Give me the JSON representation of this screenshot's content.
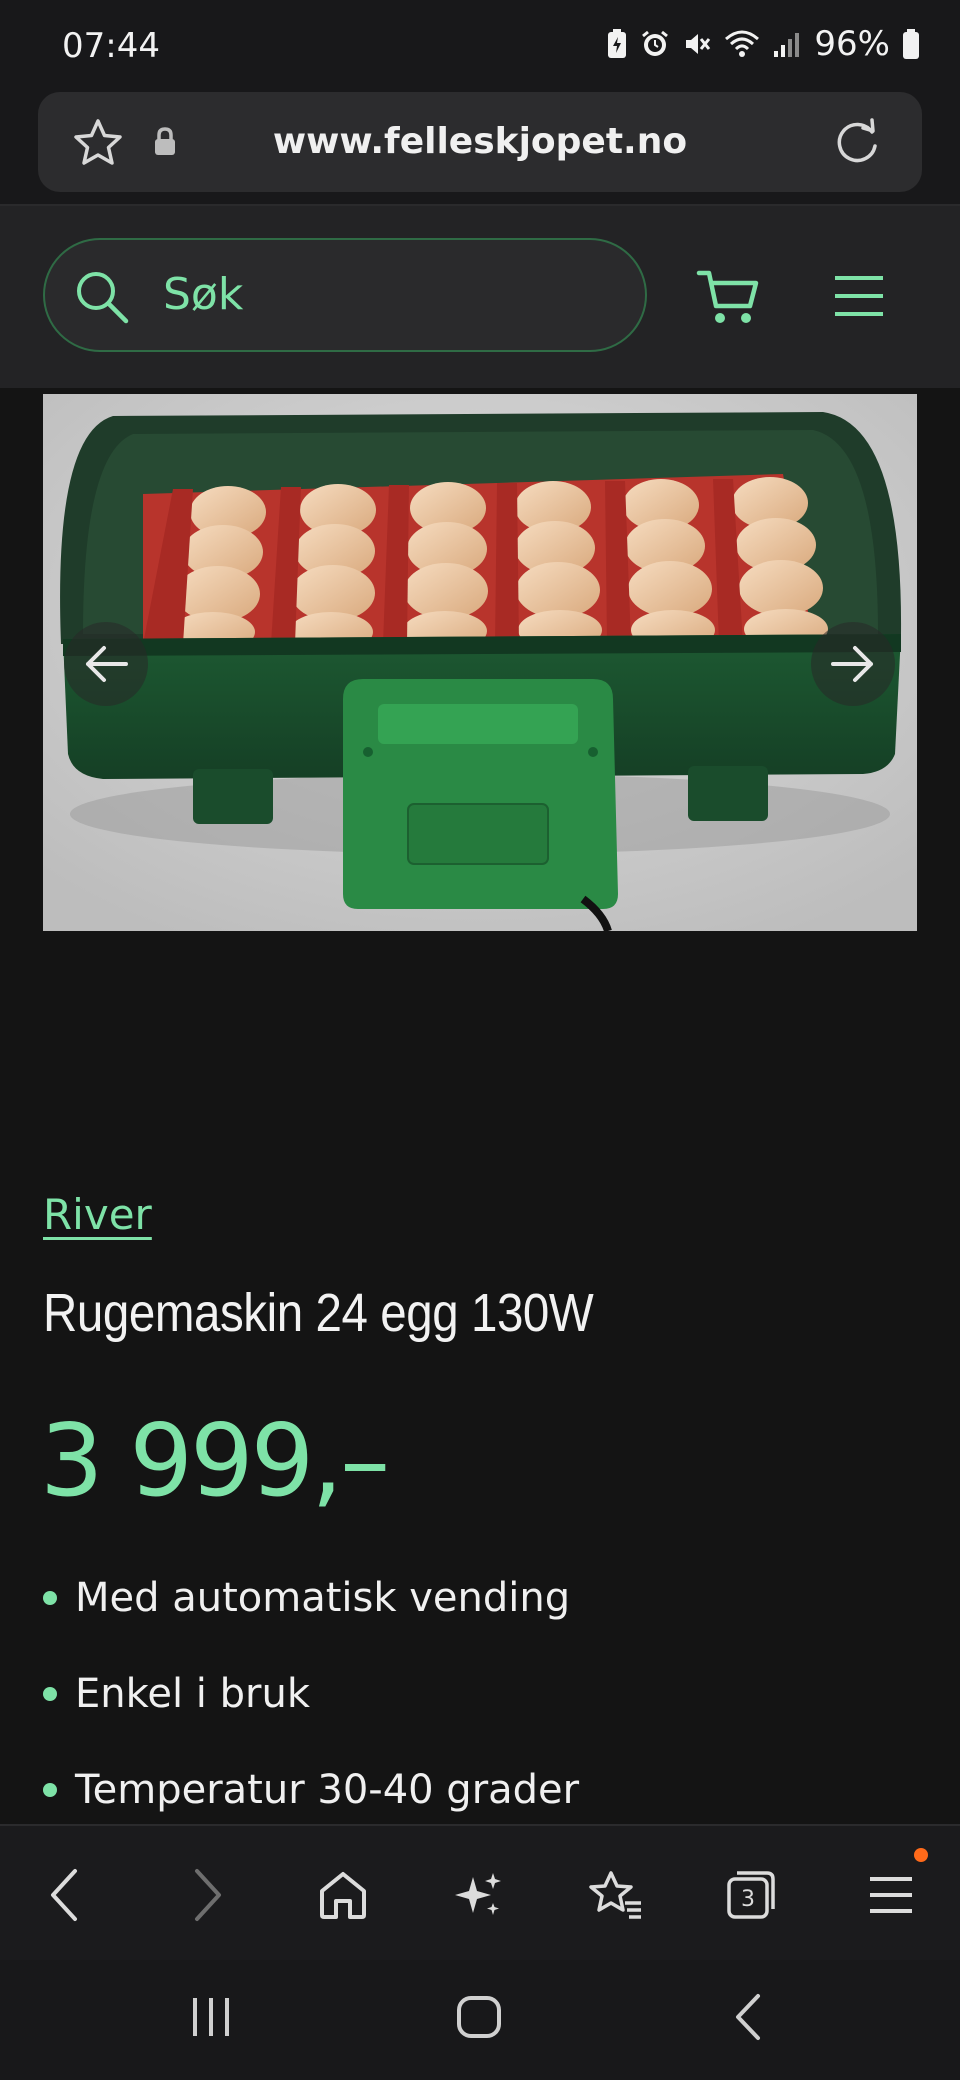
{
  "status_bar": {
    "time": "07:44",
    "battery": "96%"
  },
  "browser": {
    "url": "www.felleskjopet.no",
    "tab_count": "3"
  },
  "site_header": {
    "search_label": "Søk"
  },
  "product": {
    "brand": "River",
    "title": "Rugemaskin 24 egg 130W",
    "price": "3 999,–",
    "features": [
      "Med automatisk vending",
      "Enkel i bruk",
      "Temperatur 30-40 grader"
    ]
  },
  "colors": {
    "accent": "#7ee2a7",
    "background": "#141414",
    "header": "#232325",
    "badge": "#ff6a1a"
  },
  "icons": [
    "star-icon",
    "lock-icon",
    "reload-icon",
    "search-icon",
    "cart-icon",
    "menu-icon",
    "back-icon",
    "forward-icon",
    "home-icon",
    "sparkle-icon",
    "bookmarks-icon",
    "tabs-icon",
    "browser-menu-icon"
  ]
}
